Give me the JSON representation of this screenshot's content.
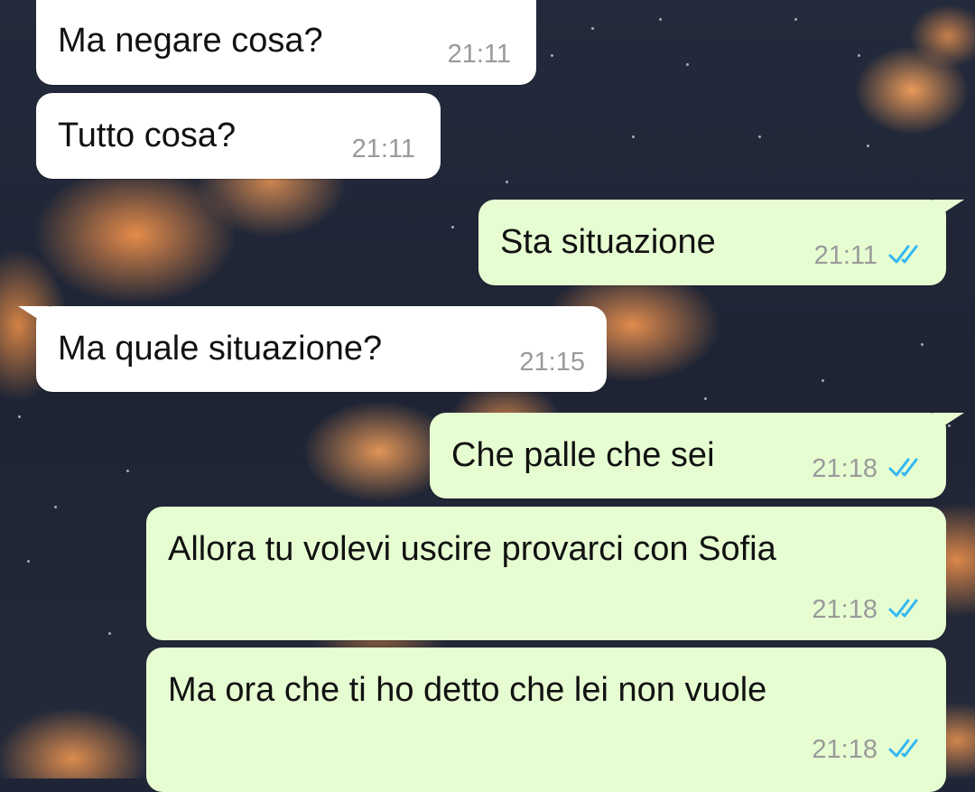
{
  "messages": [
    {
      "text": "Ma negare cosa?",
      "time": "21:11",
      "direction": "incoming"
    },
    {
      "text": "Tutto cosa?",
      "time": "21:11",
      "direction": "incoming"
    },
    {
      "text": "Sta situazione",
      "time": "21:11",
      "direction": "outgoing",
      "status": "read"
    },
    {
      "text": "Ma quale situazione?",
      "time": "21:15",
      "direction": "incoming"
    },
    {
      "text": "Che palle che sei",
      "time": "21:18",
      "direction": "outgoing",
      "status": "read"
    },
    {
      "text": "Allora tu volevi uscire  provarci con Sofia",
      "time": "21:18",
      "direction": "outgoing",
      "status": "read"
    },
    {
      "text": "Ma ora che ti ho detto che lei non vuole",
      "time": "21:18",
      "direction": "outgoing",
      "status": "read"
    }
  ],
  "colors": {
    "incoming_bubble": "#ffffff",
    "outgoing_bubble": "#e6fdd2",
    "read_ticks": "#34b7f1",
    "time_text": "#9a9a9a"
  },
  "icons": {
    "read_status": "double-check-icon"
  }
}
